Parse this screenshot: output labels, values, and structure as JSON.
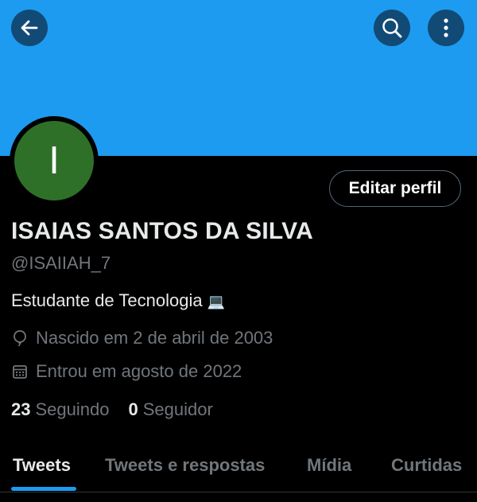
{
  "colors": {
    "banner": "#1d9bf0",
    "avatar_background": "#2f7028",
    "accent": "#1d9bf0",
    "secondary_text": "#71767b"
  },
  "header": {
    "back_icon": "arrow-left-icon",
    "search_icon": "search-icon",
    "more_icon": "more-vertical-icon"
  },
  "profile": {
    "avatar_initial": "I",
    "edit_button_label": "Editar perfil",
    "display_name": "ISAIAS SANTOS DA SILVA",
    "handle": "@ISAIIAH_7",
    "bio": "Estudante de Tecnologia",
    "bio_emoji": "💻",
    "birth_icon": "balloon-icon",
    "birth": "Nascido em 2 de abril de 2003",
    "joined_icon": "calendar-icon",
    "joined": "Entrou em agosto de 2022",
    "following_count": "23",
    "following_label": "Seguindo",
    "followers_count": "0",
    "followers_label": "Seguidor"
  },
  "tabs": [
    {
      "label": "Tweets",
      "active": true
    },
    {
      "label": "Tweets e respostas",
      "active": false
    },
    {
      "label": "Mídia",
      "active": false
    },
    {
      "label": "Curtidas",
      "active": false
    }
  ]
}
